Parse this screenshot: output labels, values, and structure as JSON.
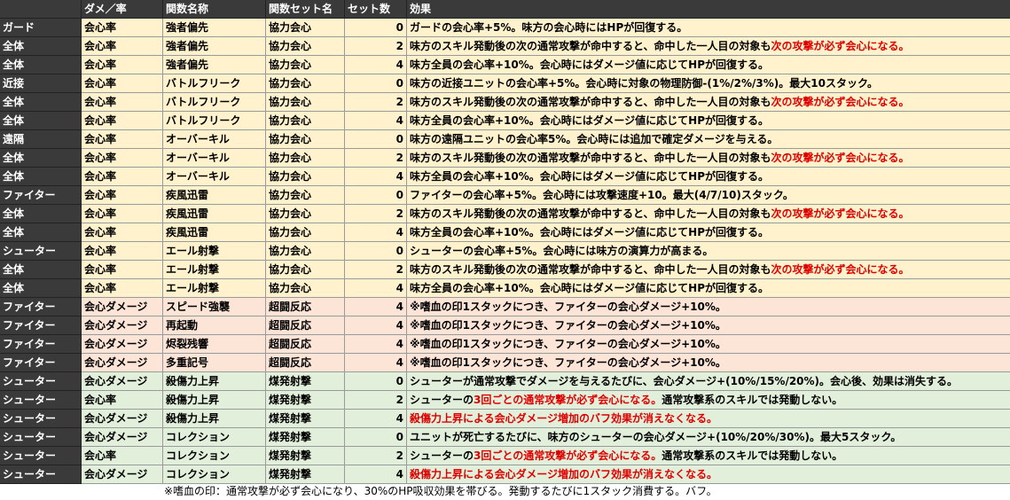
{
  "table": {
    "headers": [
      "",
      "ダメ／率",
      "関数名称",
      "関数セット名",
      "セット数",
      "効果"
    ],
    "row_colors": {
      "yellow": "#fff2cc",
      "orange": "#fce4d6",
      "green": "#e2efda",
      "white": "#ffffff",
      "header": "#3a3a3a",
      "accent_red": "#e00000"
    },
    "rows": [
      {
        "cat": "ガード",
        "type": "会心率",
        "name": "強者偏先",
        "set": "協力会心",
        "num": "0",
        "pre": "ガードの会心率+5%。味方の会心時にはHPが回復する。",
        "red": "",
        "post": "",
        "bg": "yellow"
      },
      {
        "cat": "全体",
        "type": "会心率",
        "name": "強者偏先",
        "set": "協力会心",
        "num": "2",
        "pre": "味方のスキル発動後の次の通常攻撃が命中すると、命中した一人目の対象も",
        "red": "次の攻撃が必ず会心になる。",
        "post": "",
        "bg": "yellow"
      },
      {
        "cat": "全体",
        "type": "会心率",
        "name": "強者偏先",
        "set": "協力会心",
        "num": "4",
        "pre": "味方全員の会心率+10%。会心時にはダメージ値に応じてHPが回復する。",
        "red": "",
        "post": "",
        "bg": "yellow"
      },
      {
        "cat": "近接",
        "type": "会心率",
        "name": "バトルフリーク",
        "set": "協力会心",
        "num": "0",
        "pre": "味方の近接ユニットの会心率+5%。会心時に対象の物理防御-(1%/2%/3%)。最大10スタック。",
        "red": "",
        "post": "",
        "bg": "yellow"
      },
      {
        "cat": "全体",
        "type": "会心率",
        "name": "バトルフリーク",
        "set": "協力会心",
        "num": "2",
        "pre": "味方のスキル発動後の次の通常攻撃が命中すると、命中した一人目の対象も",
        "red": "次の攻撃が必ず会心になる。",
        "post": "",
        "bg": "yellow"
      },
      {
        "cat": "全体",
        "type": "会心率",
        "name": "バトルフリーク",
        "set": "協力会心",
        "num": "4",
        "pre": "味方全員の会心率+10%。会心時にはダメージ値に応じてHPが回復する。",
        "red": "",
        "post": "",
        "bg": "yellow"
      },
      {
        "cat": "遠隔",
        "type": "会心率",
        "name": "オーバーキル",
        "set": "協力会心",
        "num": "0",
        "pre": "味方の遠隔ユニットの会心率5%。会心時には追加で確定ダメージを与える。",
        "red": "",
        "post": "",
        "bg": "yellow"
      },
      {
        "cat": "全体",
        "type": "会心率",
        "name": "オーバーキル",
        "set": "協力会心",
        "num": "2",
        "pre": "味方のスキル発動後の次の通常攻撃が命中すると、命中した一人目の対象も",
        "red": "次の攻撃が必ず会心になる。",
        "post": "",
        "bg": "yellow"
      },
      {
        "cat": "全体",
        "type": "会心率",
        "name": "オーバーキル",
        "set": "協力会心",
        "num": "4",
        "pre": "味方全員の会心率+10%。会心時にはダメージ値に応じてHPが回復する。",
        "red": "",
        "post": "",
        "bg": "yellow"
      },
      {
        "cat": "ファイター",
        "type": "会心率",
        "name": "疾風迅雷",
        "set": "協力会心",
        "num": "0",
        "pre": "ファイターの会心率+5%。会心時には攻撃速度+10。最大(4/7/10)スタック。",
        "red": "",
        "post": "",
        "bg": "yellow"
      },
      {
        "cat": "全体",
        "type": "会心率",
        "name": "疾風迅雷",
        "set": "協力会心",
        "num": "2",
        "pre": "味方のスキル発動後の次の通常攻撃が命中すると、命中した一人目の対象も",
        "red": "次の攻撃が必ず会心になる。",
        "post": "",
        "bg": "yellow"
      },
      {
        "cat": "全体",
        "type": "会心率",
        "name": "疾風迅雷",
        "set": "協力会心",
        "num": "4",
        "pre": "味方全員の会心率+10%。会心時にはダメージ値に応じてHPが回復する。",
        "red": "",
        "post": "",
        "bg": "yellow"
      },
      {
        "cat": "シューター",
        "type": "会心率",
        "name": "エール射撃",
        "set": "協力会心",
        "num": "0",
        "pre": "シューターの会心率+5%。会心時には味方の演算力が高まる。",
        "red": "",
        "post": "",
        "bg": "yellow"
      },
      {
        "cat": "全体",
        "type": "会心率",
        "name": "エール射撃",
        "set": "協力会心",
        "num": "2",
        "pre": "味方のスキル発動後の次の通常攻撃が命中すると、命中した一人目の対象も",
        "red": "次の攻撃が必ず会心になる。",
        "post": "",
        "bg": "yellow"
      },
      {
        "cat": "全体",
        "type": "会心率",
        "name": "エール射撃",
        "set": "協力会心",
        "num": "4",
        "pre": "味方全員の会心率+10%。会心時にはダメージ値に応じてHPが回復する。",
        "red": "",
        "post": "",
        "bg": "yellow"
      },
      {
        "cat": "ファイター",
        "type": "会心ダメージ",
        "name": "スピード強襲",
        "set": "超闘反応",
        "num": "4",
        "pre": "※嗜血の印1スタックにつき、ファイターの会心ダメージ+10%。",
        "red": "",
        "post": "",
        "bg": "orange"
      },
      {
        "cat": "ファイター",
        "type": "会心ダメージ",
        "name": "再起動",
        "set": "超闘反応",
        "num": "4",
        "pre": "※嗜血の印1スタックにつき、ファイターの会心ダメージ+10%。",
        "red": "",
        "post": "",
        "bg": "orange"
      },
      {
        "cat": "ファイター",
        "type": "会心ダメージ",
        "name": "烬裂残響",
        "set": "超闘反応",
        "num": "4",
        "pre": "※嗜血の印1スタックにつき、ファイターの会心ダメージ+10%。",
        "red": "",
        "post": "",
        "bg": "orange"
      },
      {
        "cat": "ファイター",
        "type": "会心ダメージ",
        "name": "多重記号",
        "set": "超闘反応",
        "num": "4",
        "pre": "※嗜血の印1スタックにつき、ファイターの会心ダメージ+10%。",
        "red": "",
        "post": "",
        "bg": "orange"
      },
      {
        "cat": "シューター",
        "type": "会心ダメージ",
        "name": "殺傷力上昇",
        "set": "煤発射撃",
        "num": "0",
        "pre": "シューターが通常攻撃でダメージを与えるたびに、会心ダメージ+(10%/15%/20%)。会心後、効果は消失する。",
        "red": "",
        "post": "",
        "bg": "green"
      },
      {
        "cat": "シューター",
        "type": "会心率",
        "name": "殺傷力上昇",
        "set": "煤発射撃",
        "num": "2",
        "pre": "シューターの",
        "red": "3回ごとの通常攻撃が必ず会心になる。",
        "post": "通常攻撃系のスキルでは発動しない。",
        "bg": "green"
      },
      {
        "cat": "シューター",
        "type": "会心ダメージ",
        "name": "殺傷力上昇",
        "set": "煤発射撃",
        "num": "4",
        "pre": "",
        "red": "殺傷力上昇による会心ダメージ増加のバフ効果が消えなくなる。",
        "post": "",
        "bg": "green"
      },
      {
        "cat": "シューター",
        "type": "会心ダメージ",
        "name": "コレクション",
        "set": "煤発射撃",
        "num": "0",
        "pre": "ユニットが死亡するたびに、味方のシューターの会心ダメージ+(10%/20%/30%)。最大5スタック。",
        "red": "",
        "post": "",
        "bg": "green"
      },
      {
        "cat": "シューター",
        "type": "会心率",
        "name": "コレクション",
        "set": "煤発射撃",
        "num": "2",
        "pre": "シューターの",
        "red": "3回ごとの通常攻撃が必ず会心になる。",
        "post": "通常攻撃系のスキルでは発動しない。",
        "bg": "green"
      },
      {
        "cat": "シューター",
        "type": "会心ダメージ",
        "name": "コレクション",
        "set": "煤発射撃",
        "num": "4",
        "pre": "",
        "red": "殺傷力上昇による会心ダメージ増加のバフ効果が消えなくなる。",
        "post": "",
        "bg": "green"
      }
    ]
  },
  "footnote": "※嗜血の印：通常攻撃が必ず会心になり、30%のHP吸収効果を帯びる。発動するたびに1スタック消費する。バフ。"
}
